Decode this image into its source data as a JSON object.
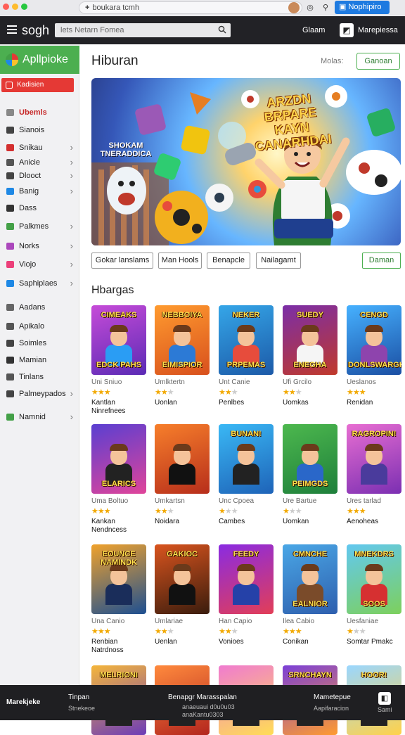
{
  "browser": {
    "url": "boukara tcmh",
    "button_label": "Nophipiro",
    "colors": {
      "close": "#ff5f57",
      "min": "#febc2e",
      "max": "#28c840"
    }
  },
  "topbar": {
    "brand": "sogh",
    "search_placeholder": "lets Netarn Fomea",
    "links": [
      "Glaam",
      "Marepiessa"
    ]
  },
  "sidebar": {
    "header": "Apllpioke",
    "highlight": "Kadisien",
    "items": [
      {
        "label": "Ubemls",
        "active": true,
        "chevron": false,
        "icon_color": "#888"
      },
      {
        "label": "Sianois",
        "chevron": false,
        "icon_color": "#444"
      },
      {
        "label": "Snikau",
        "chevron": true,
        "icon_color": "#d32f2f"
      },
      {
        "label": "Anicie",
        "chevron": true,
        "icon_color": "#555"
      },
      {
        "label": "Dlooct",
        "chevron": true,
        "icon_color": "#444"
      },
      {
        "label": "Banig",
        "chevron": true,
        "icon_color": "#1e88e5"
      },
      {
        "label": "Dass",
        "chevron": false,
        "icon_color": "#333"
      },
      {
        "label": "Palkmes",
        "chevron": true,
        "icon_color": "#43a047"
      },
      {
        "label": "Norks",
        "chevron": true,
        "icon_color": "#ab47bc"
      },
      {
        "label": "Viojo",
        "chevron": true,
        "icon_color": "#ec407a"
      },
      {
        "label": "Saphiplaes",
        "chevron": true,
        "icon_color": "#1e88e5"
      },
      {
        "label": "Aadans",
        "chevron": false,
        "icon_color": "#666"
      },
      {
        "label": "Apikalo",
        "chevron": false,
        "icon_color": "#555"
      },
      {
        "label": "Soimles",
        "chevron": false,
        "icon_color": "#444"
      },
      {
        "label": "Mamian",
        "chevron": false,
        "icon_color": "#333"
      },
      {
        "label": "Tinlans",
        "chevron": false,
        "icon_color": "#555"
      },
      {
        "label": "Palmeypados",
        "chevron": true,
        "icon_color": "#444"
      },
      {
        "label": "Namnid",
        "chevron": true,
        "icon_color": "#43a047"
      }
    ]
  },
  "main": {
    "title": "Hiburan",
    "sort_label": "Molas:",
    "sort_button": "Ganoan",
    "hero": {
      "title": "ARZDN BRPARE KAYN CANARHDAI",
      "subtitle": "SHOKAM TNERADDICA"
    },
    "chips": [
      "Gokar lanslams",
      "Man Hools",
      "Benapcle",
      "Nailagamt"
    ],
    "chip_right": "Daman",
    "section_title": "Hbargas",
    "games": [
      {
        "top": "CIMEAKS",
        "bottom": "EDCK PAHS",
        "meta": "Uni Sniuo",
        "rating": 3,
        "name": "Kantlan Ninrefnees",
        "bg": "linear-gradient(160deg,#c64bd8,#5b2bb5)",
        "body": "#2a9df4"
      },
      {
        "top": "NEBBOIYA",
        "bottom": "EIMISPIOR",
        "meta": "Umlktertn",
        "rating": 2,
        "name": "Uonlan",
        "bg": "linear-gradient(160deg,#ff9b2f,#d8501d)",
        "body": "#2c7ad6"
      },
      {
        "top": "NEKER",
        "bottom": "PRPEMAS",
        "meta": "Unt Canie",
        "rating": 2,
        "name": "Penlbes",
        "bg": "linear-gradient(160deg,#35a6e8,#1c5aa8)",
        "body": "#e74c3c"
      },
      {
        "top": "SUEDY",
        "bottom": "ENEGHA",
        "meta": "Ufi Grcilo",
        "rating": 2,
        "name": "Uomkas",
        "bg": "linear-gradient(160deg,#7b2ea8,#c0392b)",
        "body": "#f5f5f5"
      },
      {
        "top": "CENGD",
        "bottom": "DONLSWARGK",
        "meta": "Ueslanos",
        "rating": 3,
        "name": "Renidan",
        "bg": "linear-gradient(160deg,#46b1ff,#1b4fa3)",
        "body": "#8e44ad"
      },
      {
        "top": "",
        "bottom": "ELARICS",
        "meta": "Uma Boltuo",
        "rating": 3,
        "name": "Kankan Nendncess",
        "bg": "linear-gradient(160deg,#5a3fd1,#e0449a)",
        "body": "#222"
      },
      {
        "top": "",
        "bottom": "",
        "meta": "Umkartsn",
        "rating": 2,
        "name": "Noidara",
        "bg": "linear-gradient(160deg,#f77f2b,#b72e1b)",
        "body": "#111"
      },
      {
        "top": "BUNAN!",
        "bottom": "",
        "meta": "Unc Cpoea",
        "rating": 1,
        "name": "Cambes",
        "bg": "linear-gradient(160deg,#3ab8f5,#1e63b8)",
        "body": "#222"
      },
      {
        "top": "",
        "bottom": "PEIMGDS",
        "meta": "Ure Bartue",
        "rating": 1,
        "name": "Uomkan",
        "bg": "linear-gradient(160deg,#4db84e,#1e7f3b)",
        "body": "#2a67c9"
      },
      {
        "top": "RAGROPIN!",
        "bottom": "",
        "meta": "Ures tarlad",
        "rating": 3,
        "name": "Aenoheas",
        "bg": "linear-gradient(160deg,#e86ed2,#7b2fb2)",
        "body": "#4a3b9c"
      },
      {
        "top": "EOUNCE NAMINDK",
        "bottom": "",
        "meta": "Una Canio",
        "rating": 3,
        "name": "Renbian Natrdnoss",
        "bg": "linear-gradient(160deg,#f0a22c,#1d4f91)",
        "body": "#1a2d5a"
      },
      {
        "top": "GAKIOC",
        "bottom": "",
        "meta": "Umlariae",
        "rating": 2,
        "name": "Uenlan",
        "bg": "linear-gradient(160deg,#d9541e,#3a1c0d)",
        "body": "#111"
      },
      {
        "top": "FEEDY",
        "bottom": "",
        "meta": "Han Capio",
        "rating": 2,
        "name": "Vonioes",
        "bg": "linear-gradient(160deg,#8a2be2,#e23e57)",
        "body": "#2541a8"
      },
      {
        "top": "CMNCHE",
        "bottom": "EALNIOR",
        "meta": "Ilea Cabio",
        "rating": 3,
        "name": "Conikan",
        "bg": "linear-gradient(160deg,#4aa7e6,#2e5fae)",
        "body": "#7a4b2a"
      },
      {
        "top": "MNEKDRS",
        "bottom": "SOOS",
        "meta": "Uesfaniae",
        "rating": 1,
        "name": "Somtar Pmakc",
        "bg": "linear-gradient(160deg,#62c8f0,#7dd05c)",
        "body": "#d63031"
      },
      {
        "top": "MELRIONI",
        "bottom": "",
        "meta": "",
        "rating": 0,
        "name": "",
        "bg": "linear-gradient(160deg,#f5b63a,#6d3cb8)",
        "body": "#222"
      },
      {
        "top": "",
        "bottom": "",
        "meta": "",
        "rating": 0,
        "name": "",
        "bg": "linear-gradient(160deg,#ff8a3d,#b3261e)",
        "body": "#222"
      },
      {
        "top": "",
        "bottom": "",
        "meta": "",
        "rating": 0,
        "name": "",
        "bg": "linear-gradient(160deg,#f07bd0,#ffdd55)",
        "body": "#222"
      },
      {
        "top": "SRNCHAYN",
        "bottom": "",
        "meta": "",
        "rating": 0,
        "name": "",
        "bg": "linear-gradient(160deg,#7a3fd8,#ff9b2f)",
        "body": "#222"
      },
      {
        "top": "HOOR!",
        "bottom": "",
        "meta": "",
        "rating": 0,
        "name": "",
        "bg": "linear-gradient(160deg,#9ad7ff,#ffd24a)",
        "body": "#222"
      }
    ]
  },
  "footer": {
    "logo": "Marekjeke",
    "col1_title": "Tinpan",
    "col1_sub": "Stnekeoe",
    "col2_title": "Benapgr Marasspalan",
    "col2_sub1": "anaeuaui d0u0u03",
    "col2_sub2": "anaKantu0303",
    "col3_title": "Mametepue",
    "col3_sub": "Aapifaracion",
    "col4_sub": "Sami"
  }
}
